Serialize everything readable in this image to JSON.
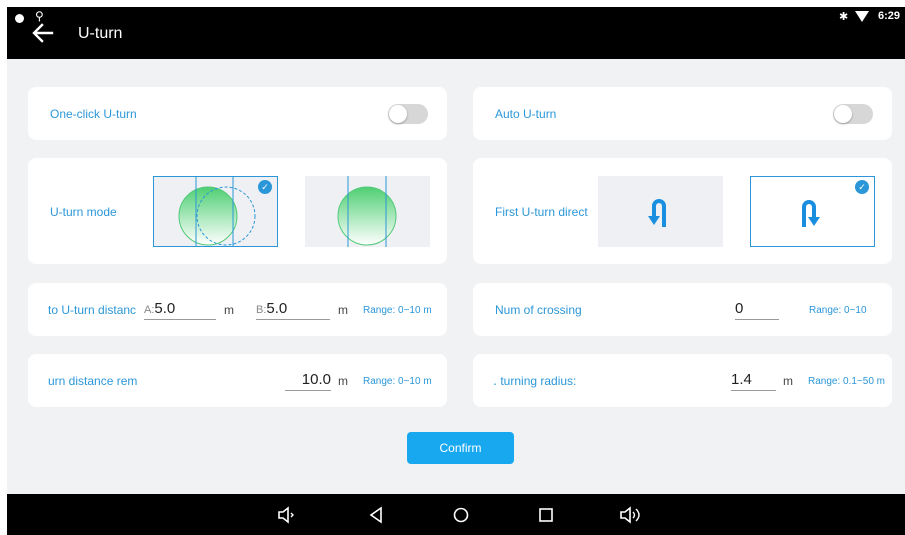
{
  "status_bar": {
    "time": "6:29"
  },
  "header": {
    "title": "U-turn"
  },
  "one_click": {
    "label": "One-click U-turn"
  },
  "auto_uturn": {
    "label": "Auto U-turn"
  },
  "uturn_mode": {
    "label": "U-turn mode"
  },
  "first_direction": {
    "label": "First U-turn direct"
  },
  "uturn_distance": {
    "label": "to U-turn distanc",
    "a_prefix": "A:",
    "a_value": "5.0",
    "a_unit": "m",
    "b_prefix": "B:",
    "b_value": "5.0",
    "b_unit": "m",
    "range": "Range: 0~10 m"
  },
  "num_crossing": {
    "label": "Num of crossing",
    "value": "0",
    "range": "Range: 0~10"
  },
  "distance_rem": {
    "label": "urn distance rem",
    "value": "10.0",
    "unit": "m",
    "range": "Range: 0~10 m"
  },
  "turning_radius": {
    "label": "․ turning radius:",
    "value": "1.4",
    "unit": "m",
    "range": "Range: 0.1~50 m"
  },
  "confirm": {
    "label": "Confirm"
  },
  "icons": {
    "back": "back-arrow-icon",
    "usb": "usb-icon",
    "bluetooth": "bluetooth-icon",
    "wifi": "wifi-icon",
    "vol_down": "volume-down-icon",
    "back_nav": "nav-back-icon",
    "home": "nav-home-icon",
    "recents": "nav-recents-icon",
    "vol_up": "volume-up-icon"
  },
  "colors": {
    "accent": "#2b97d8",
    "button": "#17a8f0",
    "bar": "#000000",
    "background": "#f1f2f4"
  }
}
